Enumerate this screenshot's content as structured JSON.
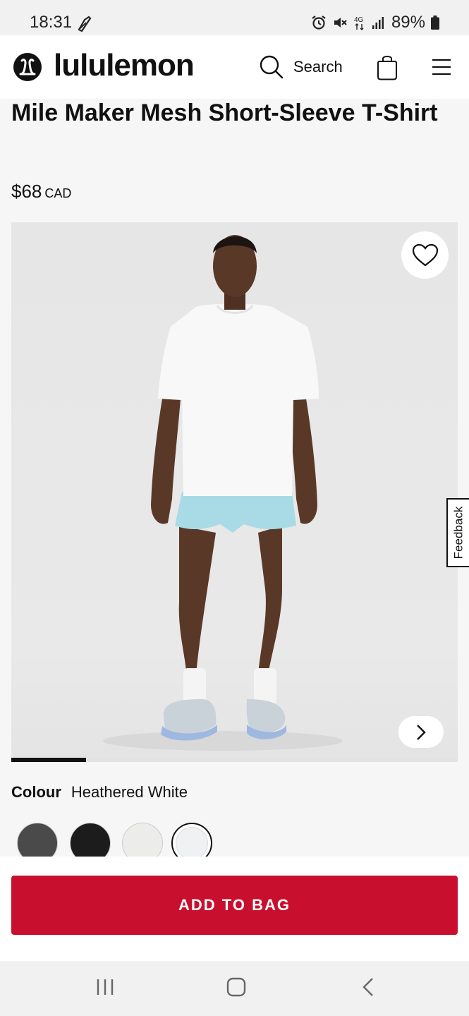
{
  "status_bar": {
    "time": "18:31",
    "battery": "89%",
    "network": "4G"
  },
  "header": {
    "brand": "lululemon",
    "search_label": "Search",
    "icons": [
      "lululemon-logo-icon",
      "search-icon",
      "shopping-bag-icon",
      "hamburger-menu-icon"
    ]
  },
  "product": {
    "title": "Mile Maker Mesh Short-Sleeve T-Shirt",
    "price": "$68",
    "currency": "CAD",
    "image_index": 1,
    "image_progress_fraction": 0.167
  },
  "feedback": {
    "label": "Feedback"
  },
  "colour": {
    "label": "Colour",
    "selected": "Heathered White",
    "swatches": [
      {
        "color": "#4a4a4a",
        "selected": false
      },
      {
        "color": "#1c1c1c",
        "selected": false
      },
      {
        "color": "#ececea",
        "selected": false
      },
      {
        "color": "#f0f1f3",
        "selected": true
      }
    ]
  },
  "cta": {
    "add_to_bag": "ADD TO BAG",
    "color": "#c8102e"
  },
  "nav": {
    "icons": [
      "recent-apps-icon",
      "home-icon",
      "back-icon"
    ]
  }
}
